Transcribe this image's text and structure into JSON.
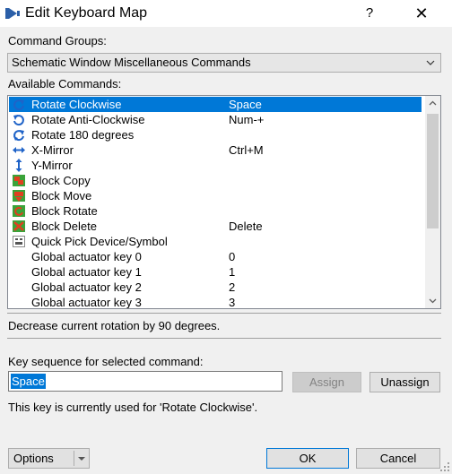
{
  "window": {
    "title": "Edit Keyboard Map",
    "help_glyph": "?",
    "close_glyph": "✕"
  },
  "groups": {
    "label": "Command Groups:",
    "selected": "Schematic Window Miscellaneous Commands"
  },
  "commands": {
    "label": "Available Commands:",
    "rows": [
      {
        "name": "Rotate Clockwise",
        "key": "Space",
        "icon": "rotate-clockwise-icon",
        "selected": true
      },
      {
        "name": "Rotate Anti-Clockwise",
        "key": "Num-+",
        "icon": "rotate-anticlockwise-icon"
      },
      {
        "name": "Rotate 180 degrees",
        "key": "",
        "icon": "rotate-180-icon"
      },
      {
        "name": "X-Mirror",
        "key": "Ctrl+M",
        "icon": "x-mirror-icon"
      },
      {
        "name": "Y-Mirror",
        "key": "",
        "icon": "y-mirror-icon"
      },
      {
        "name": "Block Copy",
        "key": "",
        "icon": "block-copy-icon"
      },
      {
        "name": "Block Move",
        "key": "",
        "icon": "block-move-icon"
      },
      {
        "name": "Block Rotate",
        "key": "",
        "icon": "block-rotate-icon"
      },
      {
        "name": "Block Delete",
        "key": "Delete",
        "icon": "block-delete-icon"
      },
      {
        "name": "Quick Pick Device/Symbol",
        "key": "",
        "icon": "quick-pick-icon"
      },
      {
        "name": "Global actuator key 0",
        "key": "0",
        "icon": ""
      },
      {
        "name": "Global actuator key 1",
        "key": "1",
        "icon": ""
      },
      {
        "name": "Global actuator key 2",
        "key": "2",
        "icon": ""
      },
      {
        "name": "Global actuator key 3",
        "key": "3",
        "icon": ""
      }
    ]
  },
  "description": "Decrease current rotation by 90 degrees.",
  "keyseq": {
    "label": "Key sequence for selected command:",
    "value": "Space",
    "assign_label": "Assign",
    "unassign_label": "Unassign",
    "usage_text": "This key is currently used for 'Rotate Clockwise'."
  },
  "footer": {
    "options_label": "Options",
    "ok_label": "OK",
    "cancel_label": "Cancel"
  },
  "colors": {
    "accent": "#0078d7",
    "window_bg": "#f0f0f0"
  }
}
